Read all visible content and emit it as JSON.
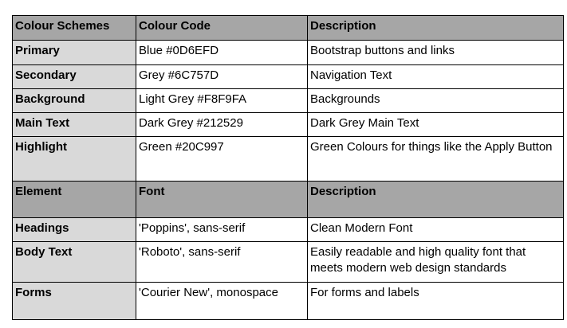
{
  "colour_table": {
    "headers": [
      "Colour Schemes",
      "Colour Code",
      "Description"
    ],
    "rows": [
      {
        "name": "Primary",
        "code": "Blue #0D6EFD",
        "description": "Bootstrap buttons and links"
      },
      {
        "name": "Secondary",
        "code": "Grey #6C757D",
        "description": "Navigation Text"
      },
      {
        "name": "Background",
        "code": "Light Grey #F8F9FA",
        "description": "Backgrounds"
      },
      {
        "name": "Main Text",
        "code": "Dark Grey #212529",
        "description": "Dark Grey Main Text"
      },
      {
        "name": "Highlight",
        "code": "Green #20C997",
        "description": "Green Colours for things like the Apply Button"
      }
    ]
  },
  "font_table": {
    "headers": [
      "Element",
      "Font",
      "Description"
    ],
    "rows": [
      {
        "name": "Headings",
        "font": "'Poppins', sans-serif",
        "description": "Clean Modern Font"
      },
      {
        "name": "Body Text",
        "font": "'Roboto', sans-serif",
        "description": "Easily readable and high quality font that meets modern web design standards"
      },
      {
        "name": "Forms",
        "font": "'Courier New', monospace",
        "description": "For forms and labels"
      }
    ]
  },
  "colors": {
    "header_fill": "#a6a6a6",
    "label_fill": "#d9d9d9",
    "border": "#000000"
  }
}
